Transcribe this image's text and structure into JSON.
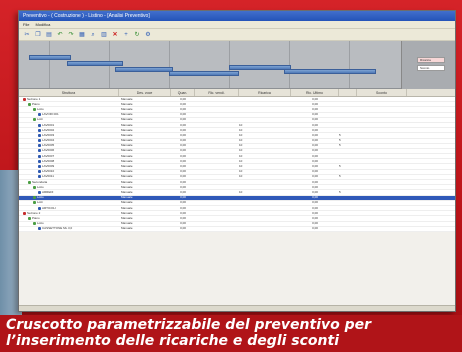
{
  "caption": {
    "line1": "Cruscotto parametrizzabile del preventivo per",
    "line2": "l’inserimento delle ricariche e degli sconti"
  },
  "window": {
    "title": "Preventivo - ( Costruzione ) - Listino - [Analisi Preventivo]",
    "menus": [
      "File",
      "Modifica"
    ],
    "toolbar_icons": [
      "cut-icon",
      "copy-icon",
      "paste-icon",
      "undo-icon",
      "redo-icon",
      "print-icon",
      "find-icon",
      "grid-icon",
      "close-icon",
      "add-icon",
      "refresh-icon",
      "settings-icon"
    ]
  },
  "gantt": {
    "side_tabs": [
      "Ricarica",
      "Sconto"
    ]
  },
  "grid": {
    "headers": [
      "Struttura",
      "Des. voce",
      "Quan.",
      "Ric. vendi.",
      "Ricarica",
      "Ric. Ultimo",
      "Sconto"
    ],
    "rows": [
      {
        "name": "Sezione 1",
        "icon": "red",
        "indent": 0,
        "desc": "Manuale",
        "qty": "0,00",
        "r1": "",
        "r2": "0,00",
        "r3": "",
        "sel": false
      },
      {
        "name": "Piano",
        "icon": "green",
        "indent": 1,
        "desc": "Manuale",
        "qty": "0,00",
        "r1": "",
        "r2": "0,00",
        "r3": "",
        "sel": false
      },
      {
        "name": "Lotto",
        "icon": "green",
        "indent": 2,
        "desc": "Manuale",
        "qty": "0,00",
        "r1": "",
        "r2": "0,00",
        "r3": "",
        "sel": false
      },
      {
        "name": "LAVORI 001",
        "icon": "blue",
        "indent": 3,
        "desc": "Manuale",
        "qty": "0,00",
        "r1": "",
        "r2": "0,00",
        "r3": "",
        "sel": false
      },
      {
        "name": "Lotti",
        "icon": "green",
        "indent": 2,
        "desc": "Manuale",
        "qty": "0,00",
        "r1": "",
        "r2": "0,00",
        "r3": "",
        "sel": false
      },
      {
        "name": "LAV0001",
        "icon": "blue",
        "indent": 3,
        "desc": "Manuale",
        "qty": "0,00",
        "r1": "10",
        "r2": "0,00",
        "r3": "",
        "sel": false
      },
      {
        "name": "LAV0002",
        "icon": "blue",
        "indent": 3,
        "desc": "Manuale",
        "qty": "0,00",
        "r1": "10",
        "r2": "0,00",
        "r3": "",
        "sel": false
      },
      {
        "name": "LAV0003",
        "icon": "blue",
        "indent": 3,
        "desc": "Manuale",
        "qty": "0,00",
        "r1": "10",
        "r2": "0,00",
        "r3": "5",
        "sel": false
      },
      {
        "name": "LAV0004",
        "icon": "blue",
        "indent": 3,
        "desc": "Manuale",
        "qty": "0,00",
        "r1": "10",
        "r2": "0,00",
        "r3": "5",
        "sel": false
      },
      {
        "name": "LAV0005",
        "icon": "blue",
        "indent": 3,
        "desc": "Manuale",
        "qty": "0,00",
        "r1": "10",
        "r2": "0,00",
        "r3": "5",
        "sel": false
      },
      {
        "name": "LAV0006",
        "icon": "blue",
        "indent": 3,
        "desc": "Manuale",
        "qty": "0,00",
        "r1": "10",
        "r2": "0,00",
        "r3": "",
        "sel": false
      },
      {
        "name": "LAV0007",
        "icon": "blue",
        "indent": 3,
        "desc": "Manuale",
        "qty": "0,00",
        "r1": "10",
        "r2": "0,00",
        "r3": "",
        "sel": false
      },
      {
        "name": "LAV0008",
        "icon": "blue",
        "indent": 3,
        "desc": "Manuale",
        "qty": "0,00",
        "r1": "10",
        "r2": "0,00",
        "r3": "",
        "sel": false
      },
      {
        "name": "LAV0009",
        "icon": "blue",
        "indent": 3,
        "desc": "Manuale",
        "qty": "0,00",
        "r1": "10",
        "r2": "0,00",
        "r3": "5",
        "sel": false
      },
      {
        "name": "LAV0010",
        "icon": "blue",
        "indent": 3,
        "desc": "Manuale",
        "qty": "0,00",
        "r1": "10",
        "r2": "0,00",
        "r3": "",
        "sel": false
      },
      {
        "name": "LAV0011",
        "icon": "blue",
        "indent": 3,
        "desc": "Manuale",
        "qty": "0,00",
        "r1": "10",
        "r2": "0,00",
        "r3": "5",
        "sel": false
      },
      {
        "name": "Secondaria",
        "icon": "green",
        "indent": 1,
        "desc": "Manuale",
        "qty": "0,00",
        "r1": "",
        "r2": "0,00",
        "r3": "",
        "sel": false
      },
      {
        "name": "Lotto",
        "icon": "green",
        "indent": 2,
        "desc": "Manuale",
        "qty": "0,00",
        "r1": "",
        "r2": "0,00",
        "r3": "",
        "sel": false
      },
      {
        "name": "ARREDI",
        "icon": "blue",
        "indent": 3,
        "desc": "Manuale",
        "qty": "0,00",
        "r1": "10",
        "r2": "0,00",
        "r3": "5",
        "sel": false
      },
      {
        "name": "Lotto",
        "icon": "green",
        "indent": 2,
        "desc": "Manuale",
        "qty": "0,00",
        "r1": "",
        "r2": "0,00",
        "r3": "",
        "sel": true
      },
      {
        "name": "Lotti",
        "icon": "green",
        "indent": 2,
        "desc": "Manuale",
        "qty": "0,00",
        "r1": "",
        "r2": "0,00",
        "r3": "",
        "sel": false
      },
      {
        "name": "ARTICOLI",
        "icon": "blue",
        "indent": 3,
        "desc": "Manuale",
        "qty": "0,00",
        "r1": "",
        "r2": "0,00",
        "r3": "",
        "sel": false
      },
      {
        "name": "Sezione 2",
        "icon": "red",
        "indent": 0,
        "desc": "Manuale",
        "qty": "0,00",
        "r1": "",
        "r2": "0,00",
        "r3": "",
        "sel": false
      },
      {
        "name": "Piano",
        "icon": "green",
        "indent": 1,
        "desc": "Manuale",
        "qty": "0,00",
        "r1": "",
        "r2": "0,00",
        "r3": "",
        "sel": false
      },
      {
        "name": "Lotto",
        "icon": "green",
        "indent": 2,
        "desc": "Manuale",
        "qty": "0,00",
        "r1": "",
        "r2": "0,00",
        "r3": "",
        "sel": false
      },
      {
        "name": "CASSETTONE ML 3,0",
        "icon": "blue",
        "indent": 3,
        "desc": "Manuale",
        "qty": "0,00",
        "r1": "",
        "r2": "0,00",
        "r3": "",
        "sel": false
      }
    ]
  }
}
